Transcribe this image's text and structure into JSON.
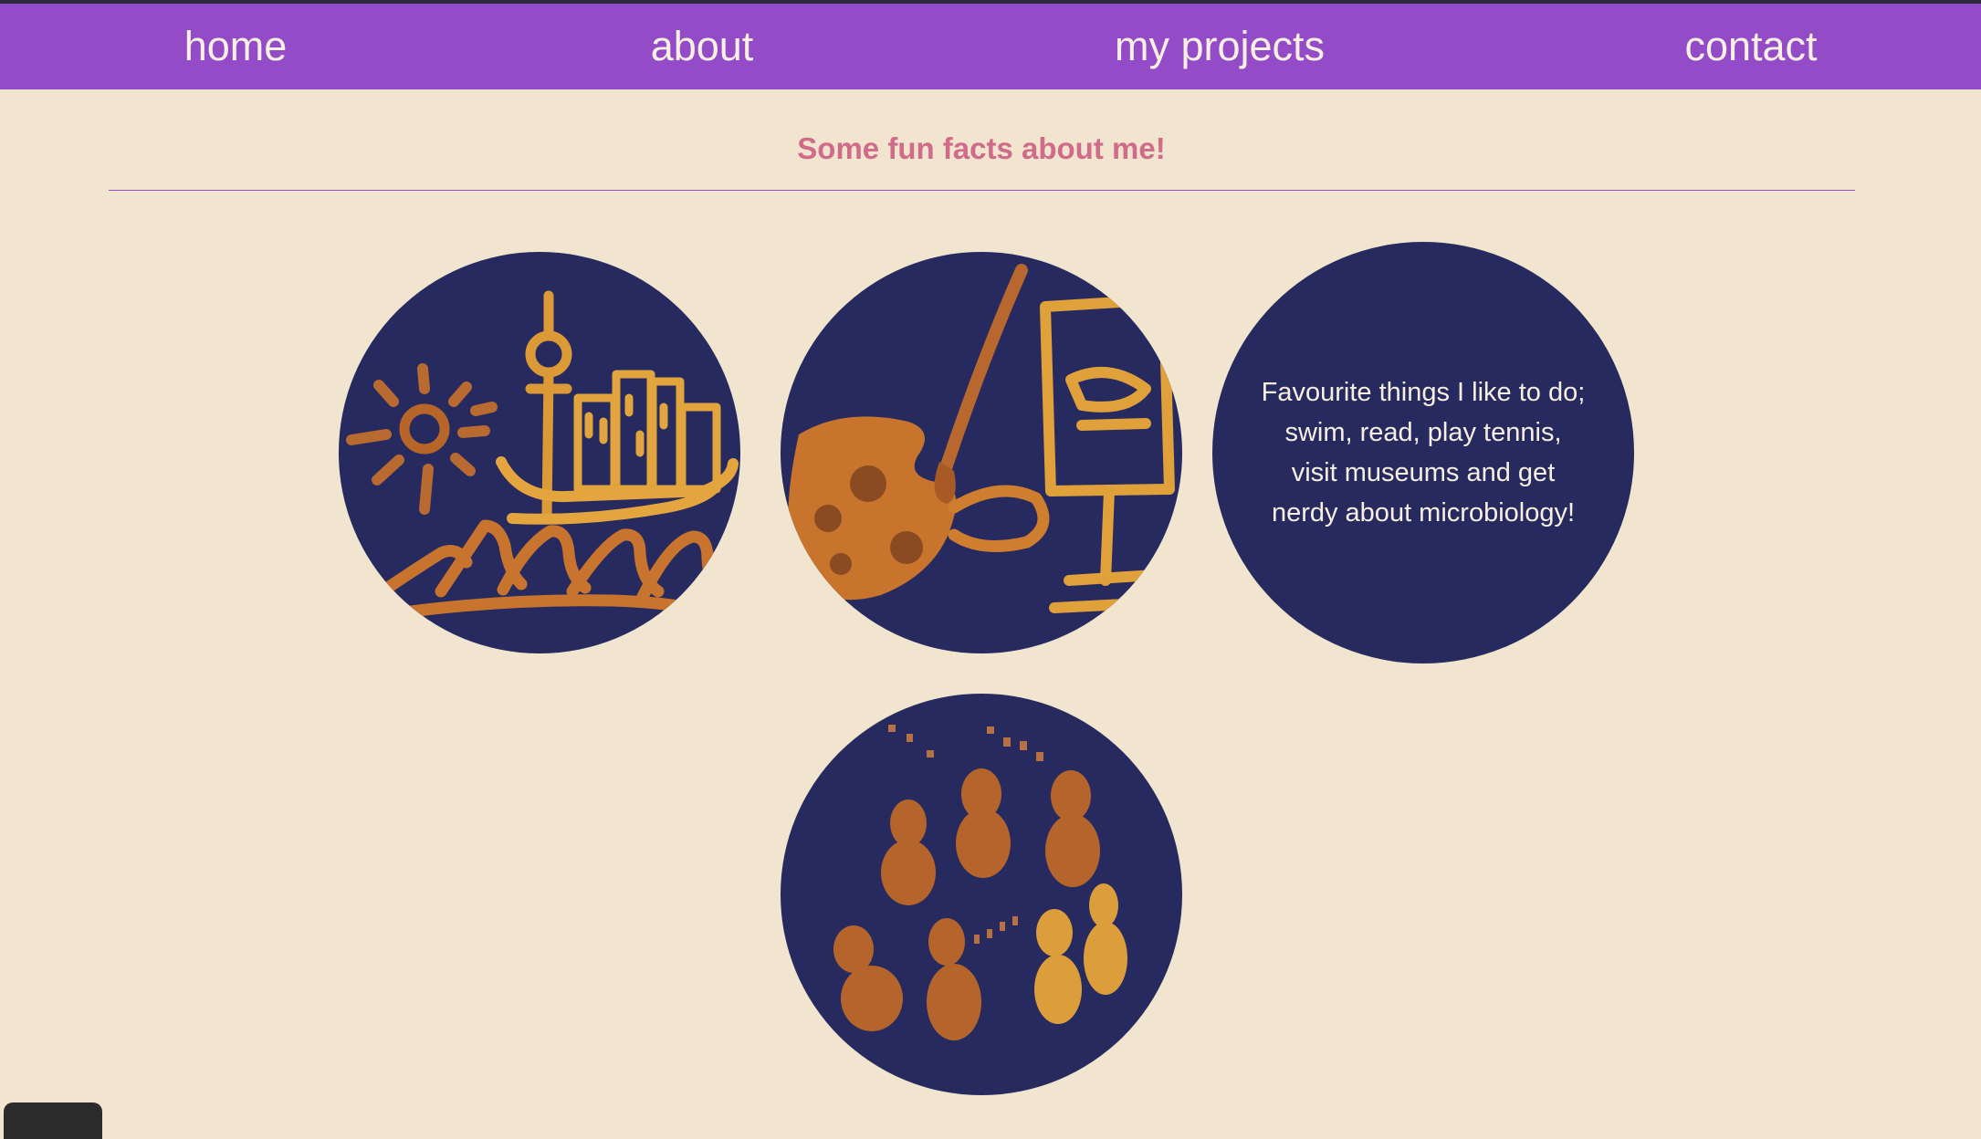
{
  "nav": {
    "items": [
      {
        "label": "home"
      },
      {
        "label": "about"
      },
      {
        "label": "my projects"
      },
      {
        "label": "contact"
      }
    ]
  },
  "section": {
    "heading": "Some fun facts about me!"
  },
  "facts": {
    "text": "Favourite things I like to do; swim, read, play tennis, visit museums and get nerdy about microbiology!"
  },
  "colors": {
    "background": "#f1e5cf",
    "nav": "#944bc8",
    "heading": "#d06b8a",
    "circle": "#262a5e",
    "paint": "#d5892e"
  },
  "illustrations": [
    "city-skyline-icon",
    "painting-easel-icon",
    "peanuts-icon"
  ]
}
